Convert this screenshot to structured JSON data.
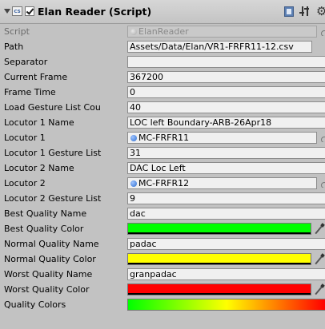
{
  "header": {
    "script_icon": "script-file-icon",
    "enabled": true,
    "title": "Elan Reader (Script)",
    "reference_icon": "book-reference-icon",
    "layout_icon": "sliders-icon",
    "gear_icon": "⚙"
  },
  "fields": {
    "script": {
      "label": "Script",
      "value": "ElanReader"
    },
    "path": {
      "label": "Path",
      "value": "Assets/Data/Elan/VR1-FRFR11-12.csv"
    },
    "separator": {
      "label": "Separator",
      "value": ""
    },
    "current_frame": {
      "label": "Current Frame",
      "value": "367200"
    },
    "frame_time": {
      "label": "Frame Time",
      "value": "0"
    },
    "load_gesture_list_count": {
      "label": "Load Gesture List Cou",
      "value": "40"
    },
    "locutor1_name": {
      "label": "Locutor 1 Name",
      "value": "LOC left Boundary-ARB-26Apr18"
    },
    "locutor1": {
      "label": "Locutor 1",
      "value": "MC-FRFR11"
    },
    "locutor1_gesture_list": {
      "label": "Locutor 1 Gesture List",
      "value": "31"
    },
    "locutor2_name": {
      "label": "Locutor 2 Name",
      "value": "DAC Loc Left"
    },
    "locutor2": {
      "label": "Locutor 2",
      "value": "MC-FRFR12"
    },
    "locutor2_gesture_list": {
      "label": "Locutor 2 Gesture List",
      "value": "9"
    },
    "best_quality_name": {
      "label": "Best Quality Name",
      "value": "dac"
    },
    "best_quality_color": {
      "label": "Best Quality Color",
      "color": "#00ff00"
    },
    "normal_quality_name": {
      "label": "Normal Quality Name",
      "value": "padac"
    },
    "normal_quality_color": {
      "label": "Normal Quality Color",
      "color": "#ffff00"
    },
    "worst_quality_name": {
      "label": "Worst Quality Name",
      "value": "granpadac"
    },
    "worst_quality_color": {
      "label": "Worst Quality Color",
      "color": "#ff0000"
    },
    "quality_colors": {
      "label": "Quality Colors",
      "gradient": [
        "#00ff00",
        "#ffff00",
        "#ff0000"
      ]
    }
  }
}
